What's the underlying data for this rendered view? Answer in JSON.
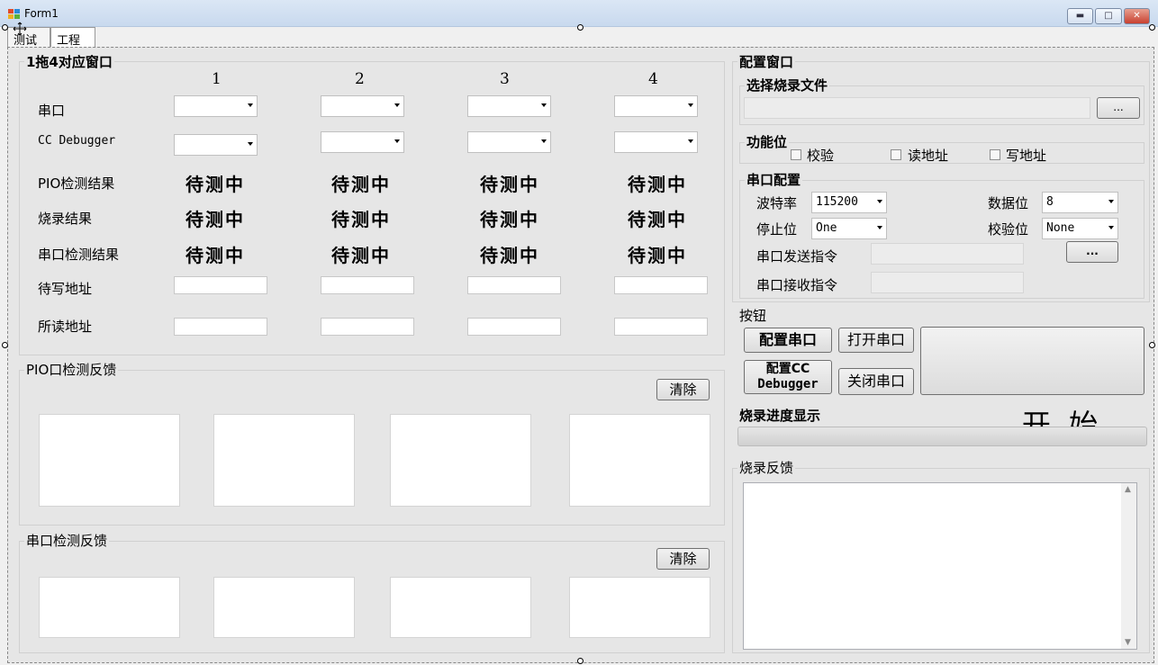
{
  "window": {
    "title": "Form1",
    "min_icon": "minimize-icon",
    "max_icon": "maximize-icon",
    "close_icon": "close-icon"
  },
  "tabs": [
    "测试",
    "工程"
  ],
  "group_main": {
    "title": "1拖4对应窗口",
    "columns": [
      "1",
      "2",
      "3",
      "4"
    ],
    "rows": {
      "serial": "串口",
      "cc": "CC Debugger",
      "pio": "PIO检测结果",
      "burn": "烧录结果",
      "serial_test": "串口检测结果",
      "write_addr": "待写地址",
      "read_addr": "所读地址"
    },
    "status_text": "待测中"
  },
  "group_pio": {
    "title": "PIO口检测反馈",
    "clear": "清除"
  },
  "group_serial_fb": {
    "title": "串口检测反馈",
    "clear": "清除"
  },
  "config": {
    "title": "配置窗口",
    "file_group": "选择烧录文件",
    "browse": "...",
    "func_group": "功能位",
    "checks": [
      "校验",
      "读地址",
      "写地址"
    ],
    "serial_group": "串口配置",
    "baud_label": "波特率",
    "baud_value": "115200",
    "databits_label": "数据位",
    "databits_value": "8",
    "stopbits_label": "停止位",
    "stopbits_value": "One",
    "parity_label": "校验位",
    "parity_value": "None",
    "send_label": "串口发送指令",
    "recv_label": "串口接收指令",
    "send_browse": "..."
  },
  "buttons": {
    "title": "按钮",
    "config_serial": "配置串口",
    "open_serial": "打开串口",
    "config_cc_line1": "配置CC",
    "config_cc_line2": "Debugger",
    "close_serial": "关闭串口",
    "start": "开  始"
  },
  "progress": {
    "title": "烧录进度显示",
    "value": 0
  },
  "feedback": {
    "title": "烧录反馈"
  }
}
